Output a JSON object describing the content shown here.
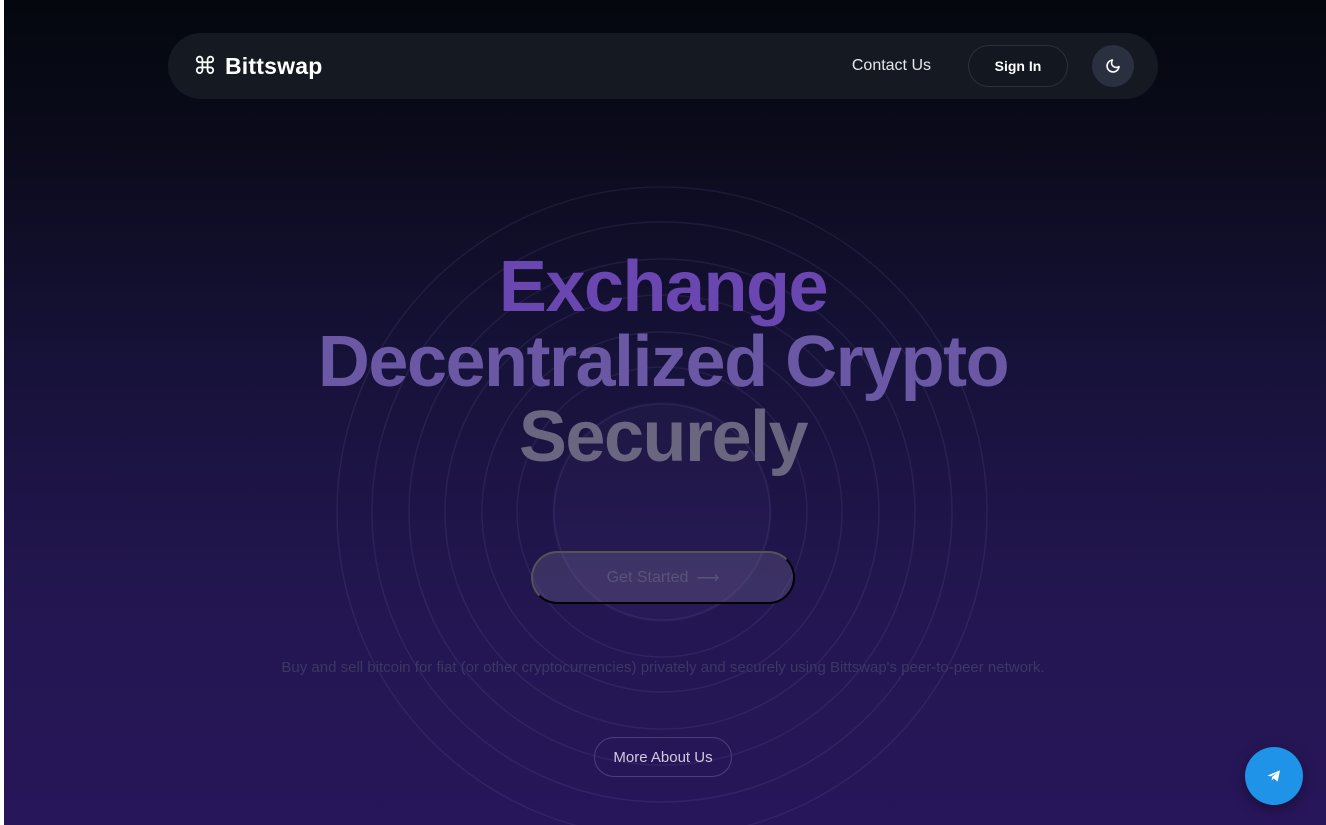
{
  "header": {
    "brand_icon": "⌘",
    "brand_name": "Bittswap",
    "contact_label": "Contact Us",
    "signin_label": "Sign In",
    "theme_icon": "moon-icon"
  },
  "hero": {
    "title_line1": "Exchange",
    "title_line2": "Decentralized Crypto",
    "title_line3": "Securely",
    "cta_label": "Get Started",
    "cta_arrow": "⟶",
    "description": "Buy and sell bitcoin for fiat (or other cryptocurrencies) privately and securely using Bittswap's peer-to-peer network.",
    "more_label": "More About Us"
  },
  "fab": {
    "icon": "telegram-send-icon"
  },
  "colors": {
    "accent": "#6a46b0",
    "fab": "#1e93e8",
    "nav_bg": "#161b24"
  }
}
